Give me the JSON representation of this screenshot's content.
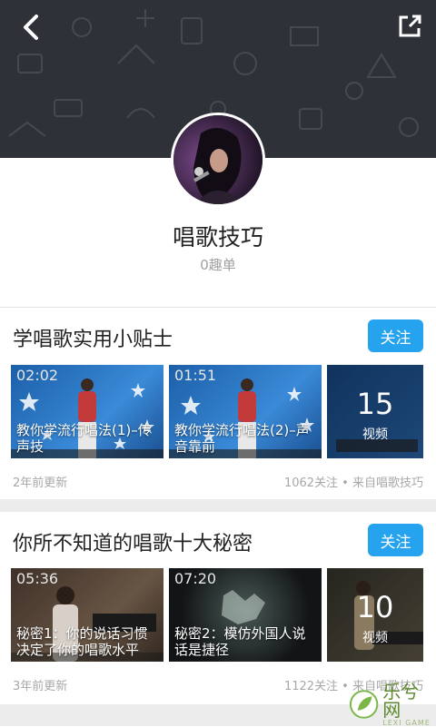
{
  "header": {
    "back_icon": "back-arrow-icon",
    "share_icon": "share-external-icon",
    "bg_color": "#2e3138"
  },
  "channel": {
    "title": "唱歌技巧",
    "subtitle": "0趣单"
  },
  "playlists": [
    {
      "title": "学唱歌实用小贴士",
      "follow_label": "关注",
      "videos": [
        {
          "duration": "02:02",
          "caption": "教你学流行唱法(1)–传声技"
        },
        {
          "duration": "01:51",
          "caption": "教你学流行唱法(2)–声音靠前"
        }
      ],
      "count": "15",
      "count_label": "视频",
      "updated": "2年前更新",
      "stats": "1062关注 • 来自唱歌技巧"
    },
    {
      "title": "你所不知道的唱歌十大秘密",
      "follow_label": "关注",
      "videos": [
        {
          "duration": "05:36",
          "caption": "秘密1：你的说话习惯决定了你的唱歌水平"
        },
        {
          "duration": "07:20",
          "caption": "秘密2：模仿外国人说话是捷径"
        }
      ],
      "count": "10",
      "count_label": "视频",
      "updated": "3年前更新",
      "stats": "1122关注 • 来自唱歌技巧"
    }
  ],
  "watermark": {
    "text": "乐兮网",
    "sub": "LEXI GAME"
  },
  "colors": {
    "accent": "#25a3ef",
    "muted": "#a8a8a8"
  }
}
